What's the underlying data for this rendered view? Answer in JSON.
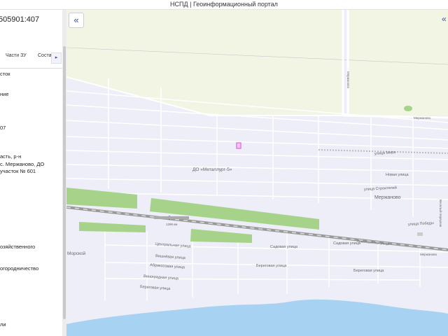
{
  "app": {
    "title": "НСПД | Геоинформационный портал"
  },
  "panel": {
    "cadastral_number": "505901:407",
    "tabs": [
      "Части ЗУ",
      "Соста"
    ],
    "tab_next": "▸",
    "lines": [
      "сток",
      "ние",
      "07",
      "асть, р-н",
      "с. Мержаново, ДО",
      "участок № 601",
      "озяйственного",
      "огородничество",
      "ли"
    ]
  },
  "map": {
    "collapse_icon": "«",
    "top_right_icon": "«",
    "labels": {
      "settlement": "ДО «Металлург-5»",
      "village": "Мержаново",
      "station": "1296 км",
      "morskoy": "Морской",
      "road_mira": "улица Мира",
      "road_novaya": "Новая улица",
      "road_stroiteley": "улица Строителей",
      "road_pobedy": "улица Победы",
      "road_merzhanovo": "Мержаново",
      "road_central": "Центральная улица",
      "road_vishnevaya": "Вишнёвая улица",
      "road_abrikosovaya": "Абрикосовая улица",
      "road_vinogradnaya": "Виноградная улица",
      "road_beregovaya": "Береговая улица",
      "road_sadovaya": "Садовая улица",
      "road_sadovaya2": "Садовая улица",
      "road_beregovaya2": "Береговая улица",
      "road_beregovaya3": "Береговая улица",
      "road_privokzalnaya": "Привокзальная улица",
      "road_merzhanovo2": "Мержаново",
      "road_vertical": "Мержаново",
      "road_right_vertical": "Веселый переулок"
    },
    "colors": {
      "field": "#f2f4e4",
      "urban": "#edeef8",
      "green": "#a7d28a",
      "sea": "#a8d2f1",
      "parcel": "#e060e0",
      "accent": "#3a4fb5"
    }
  }
}
